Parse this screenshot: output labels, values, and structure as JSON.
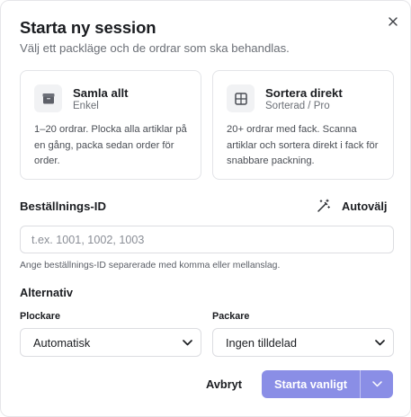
{
  "dialog": {
    "title": "Starta ny session",
    "subtitle": "Välj ett packläge och de ordrar som ska behandlas."
  },
  "modes": [
    {
      "icon": "box-icon",
      "title": "Samla allt",
      "subtitle": "Enkel",
      "description": "1–20 ordrar. Plocka alla artiklar på en gång, packa sedan order för order."
    },
    {
      "icon": "grid-icon",
      "title": "Sortera direkt",
      "subtitle": "Sorterad / Pro",
      "description": "20+ ordrar med fack. Scanna artiklar och sortera direkt i fack för snabbare packning."
    }
  ],
  "order_ids": {
    "label": "Beställnings-ID",
    "autoselect_label": "Autovälj",
    "value": "",
    "placeholder": "t.ex. 1001, 1002, 1003",
    "hint": "Ange beställnings-ID separerade med komma eller mellanslag."
  },
  "options": {
    "title": "Alternativ",
    "picker": {
      "label": "Plockare",
      "value": "Automatisk"
    },
    "packer": {
      "label": "Packare",
      "value": "Ingen tilldelad"
    }
  },
  "actions": {
    "cancel_label": "Avbryt",
    "primary_label": "Starta vanligt"
  },
  "colors": {
    "primary": "#8a8ee6",
    "border": "#e3e4e8",
    "muted_text": "#6b6f76"
  }
}
